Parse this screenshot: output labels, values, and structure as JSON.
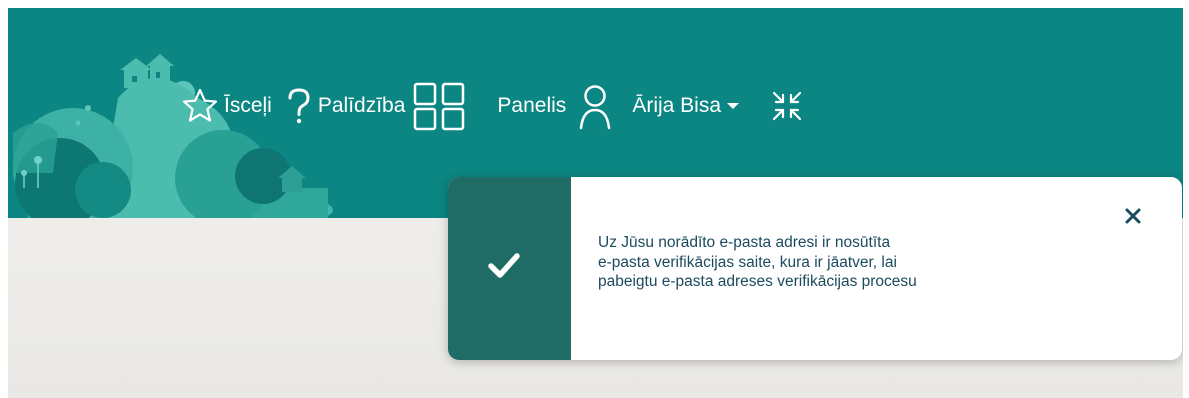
{
  "header": {
    "nav": {
      "favorites_label": "Īsceļi",
      "help_label": "Palīdzība",
      "dashboard_label": "Panelis",
      "user_label": "Ārija Bisa"
    }
  },
  "notification": {
    "lines": [
      "Uz Jūsu norādīto e-pasta adresi ir nosūtīta",
      "e-pasta verifikācijas saite, kura ir jāatver, lai",
      "pabeigtu e-pasta adreses verifikācijas procesu"
    ],
    "close_label": "×"
  },
  "colors": {
    "header_bg": "#0b8683",
    "toast_accent": "#1f6b66",
    "toast_text": "#1c4a5e"
  },
  "icons": {
    "favorites": "star-icon",
    "help": "question-icon",
    "dashboard": "grid-icon",
    "user": "user-icon",
    "dropdown": "caret-down-icon",
    "collapse": "collapse-icon",
    "success": "checkmark-icon"
  }
}
